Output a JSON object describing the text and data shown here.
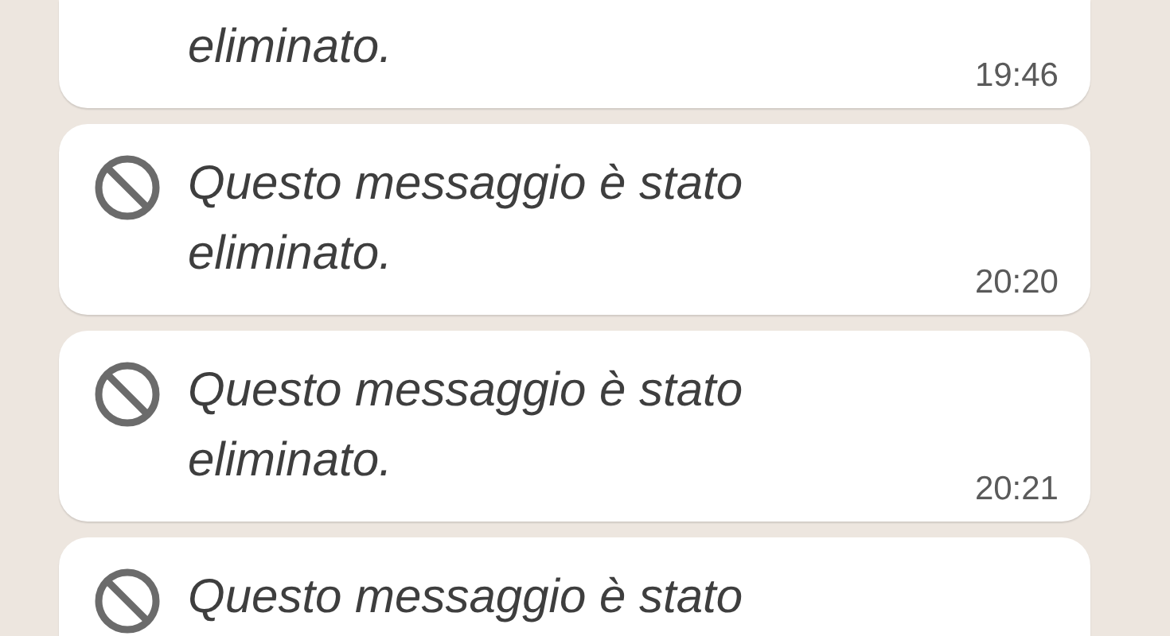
{
  "messages": [
    {
      "kind": "cut_top",
      "text": "eliminato.",
      "time": "19:46"
    },
    {
      "kind": "full",
      "text": "Questo messaggio è stato eliminato.",
      "time": "20:20"
    },
    {
      "kind": "full",
      "text": "Questo messaggio è stato eliminato.",
      "time": "20:21"
    },
    {
      "kind": "cut_bottom",
      "text": "Questo messaggio è stato"
    }
  ]
}
